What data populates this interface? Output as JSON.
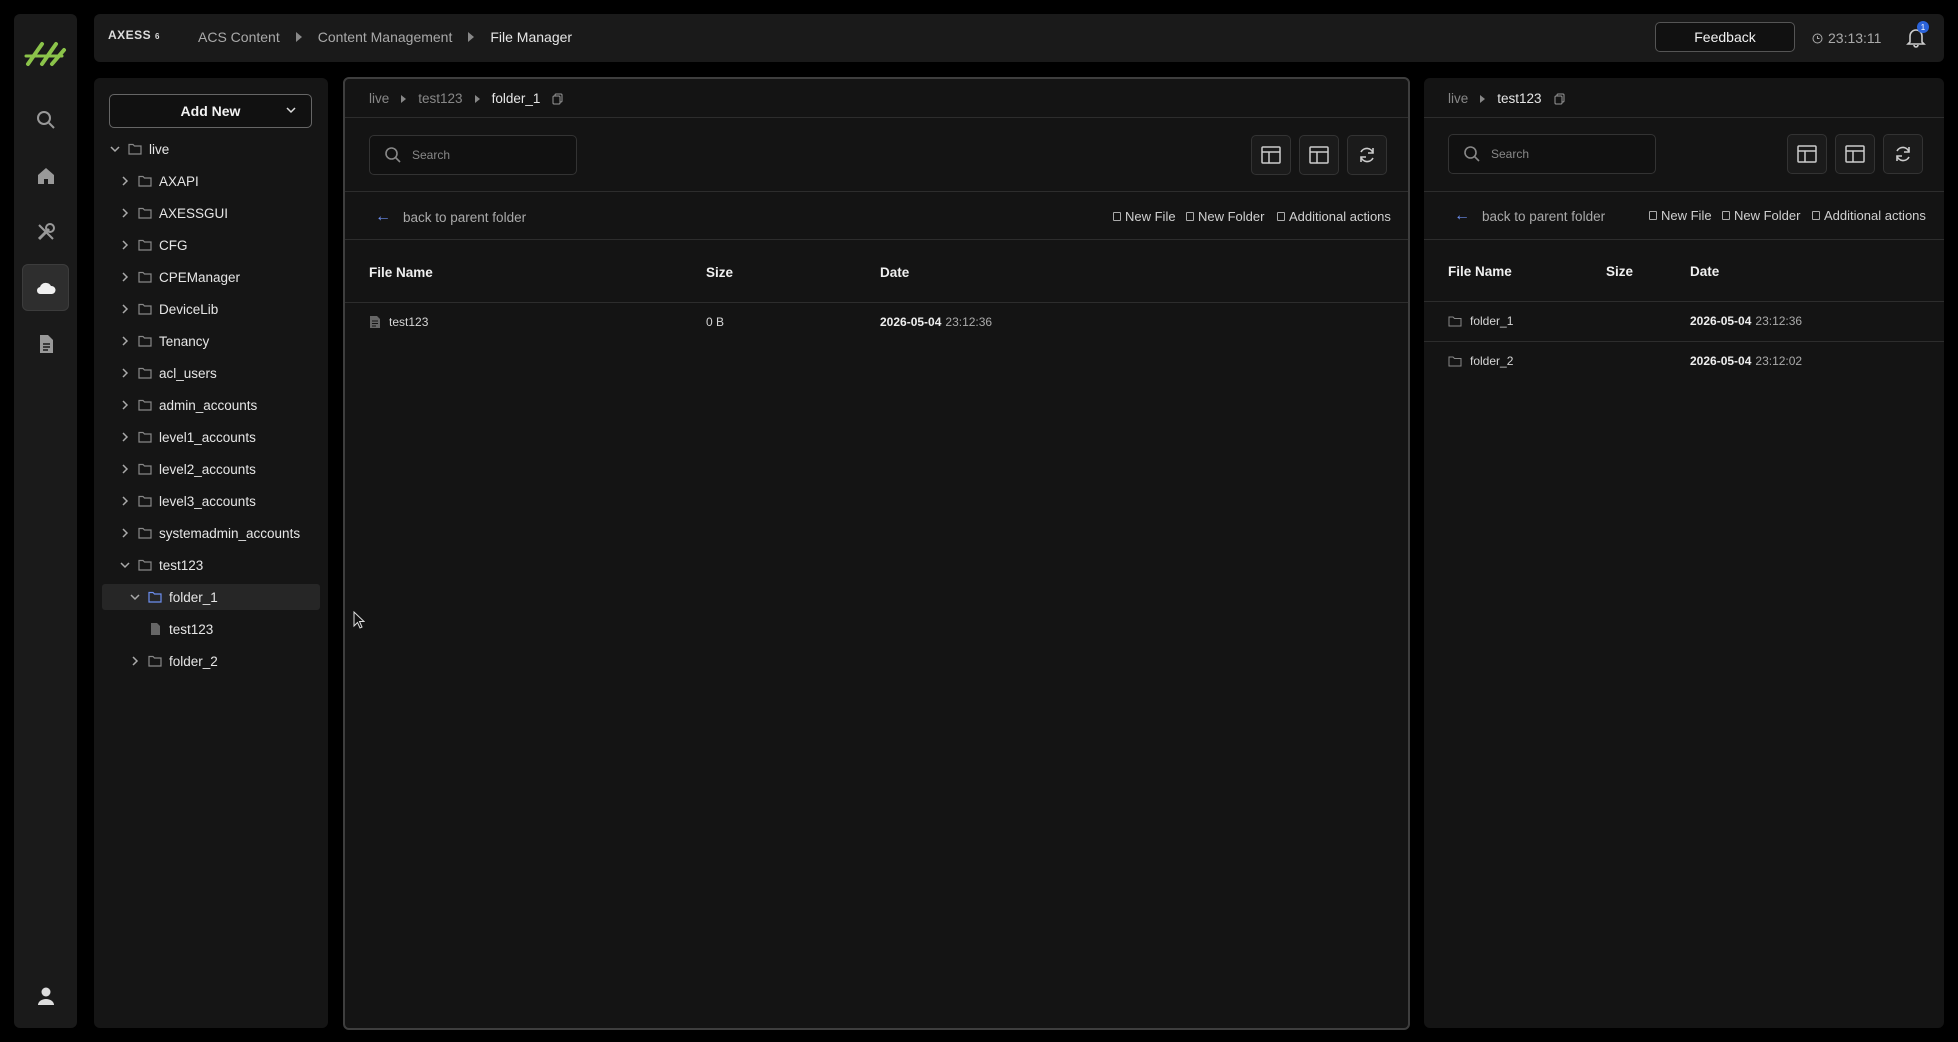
{
  "app": {
    "brand": "AXESS",
    "brand_version": "6"
  },
  "breadcrumb": [
    "ACS Content",
    "Content Management",
    "File Manager"
  ],
  "header": {
    "feedback_label": "Feedback",
    "clock": "23:13:11",
    "notification_count": "1"
  },
  "rail": {
    "items": [
      {
        "icon": "search-icon"
      },
      {
        "icon": "home-icon"
      },
      {
        "icon": "tools-icon"
      },
      {
        "icon": "cloud-icon",
        "active": true
      },
      {
        "icon": "document-icon"
      }
    ],
    "bottom_icon": "user-icon"
  },
  "tree": {
    "add_new_label": "Add New",
    "nodes": [
      {
        "label": "live",
        "expanded": true
      },
      {
        "label": "AXAPI"
      },
      {
        "label": "AXESSGUI"
      },
      {
        "label": "CFG"
      },
      {
        "label": "CPEManager"
      },
      {
        "label": "DeviceLib"
      },
      {
        "label": "Tenancy"
      },
      {
        "label": "acl_users"
      },
      {
        "label": "admin_accounts"
      },
      {
        "label": "level1_accounts"
      },
      {
        "label": "level2_accounts"
      },
      {
        "label": "level3_accounts"
      },
      {
        "label": "systemadmin_accounts"
      },
      {
        "label": "test123",
        "expanded": true
      },
      {
        "label": "folder_1",
        "expanded": true,
        "selected": true
      },
      {
        "label": "test123",
        "type": "file"
      },
      {
        "label": "folder_2"
      }
    ]
  },
  "left_panel": {
    "path": [
      "live",
      "test123",
      "folder_1"
    ],
    "search_placeholder": "Search",
    "back_label": "back to parent folder",
    "actions": [
      "New File",
      "New Folder",
      "Additional actions"
    ],
    "columns": [
      "File Name",
      "Size",
      "Date"
    ],
    "rows": [
      {
        "name": "test123",
        "type": "file",
        "size": "0 B",
        "date": "2026-05-04",
        "time": "23:12:36"
      }
    ]
  },
  "right_panel": {
    "path": [
      "live",
      "test123"
    ],
    "search_placeholder": "Search",
    "back_label": "back to parent folder",
    "actions": [
      "New File",
      "New Folder",
      "Additional actions"
    ],
    "columns": [
      "File Name",
      "Size",
      "Date"
    ],
    "rows": [
      {
        "name": "folder_1",
        "type": "folder",
        "size": "",
        "date": "2026-05-04",
        "time": "23:12:36"
      },
      {
        "name": "folder_2",
        "type": "folder",
        "size": "",
        "date": "2026-05-04",
        "time": "23:12:02"
      }
    ]
  },
  "colors": {
    "accent": "#6d8ff0",
    "logo": "#8bc34a",
    "badge": "#2b63d9"
  }
}
